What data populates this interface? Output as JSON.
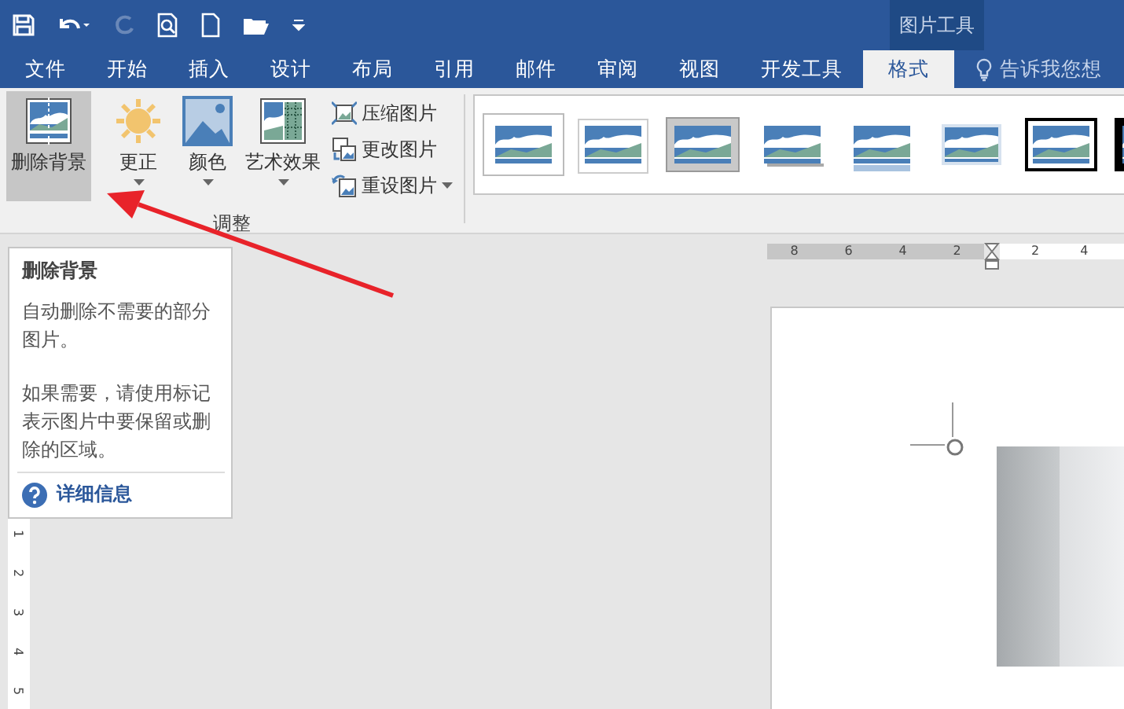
{
  "contextual_tab_group": "图片工具",
  "tabs": [
    {
      "label": "文件",
      "selected": false
    },
    {
      "label": "开始",
      "selected": false
    },
    {
      "label": "插入",
      "selected": false
    },
    {
      "label": "设计",
      "selected": false
    },
    {
      "label": "布局",
      "selected": false
    },
    {
      "label": "引用",
      "selected": false
    },
    {
      "label": "邮件",
      "selected": false
    },
    {
      "label": "审阅",
      "selected": false
    },
    {
      "label": "视图",
      "selected": false
    },
    {
      "label": "开发工具",
      "selected": false
    },
    {
      "label": "格式",
      "selected": true
    }
  ],
  "tell_me": "告诉我您想",
  "ribbon": {
    "large_buttons": [
      {
        "kind": "remove-background",
        "label": "删除背景",
        "selected": true,
        "dropdown": false
      },
      {
        "kind": "corrections",
        "label": "更正",
        "selected": false,
        "dropdown": true
      },
      {
        "kind": "color",
        "label": "颜色",
        "selected": false,
        "dropdown": true
      },
      {
        "kind": "artistic",
        "label": "艺术效果",
        "selected": false,
        "dropdown": true
      }
    ],
    "small_buttons": [
      {
        "kind": "compress",
        "label": "压缩图片",
        "dropdown": false
      },
      {
        "kind": "change",
        "label": "更改图片",
        "dropdown": false
      },
      {
        "kind": "reset",
        "label": "重设图片",
        "dropdown": true
      }
    ],
    "group_label": "调整",
    "picture_styles": [
      {
        "kind": "plain"
      },
      {
        "kind": "white-frame"
      },
      {
        "kind": "gray-frame"
      },
      {
        "kind": "soft-shadow"
      },
      {
        "kind": "reflection"
      },
      {
        "kind": "soft-edge"
      },
      {
        "kind": "double-frame"
      },
      {
        "kind": "black-frame"
      }
    ]
  },
  "ruler": {
    "left_numbers": [
      "8",
      "6",
      "4",
      "2"
    ],
    "right_numbers": [
      "2",
      "4"
    ]
  },
  "vertical_ruler": [
    "1",
    "2",
    "3",
    "4",
    "5"
  ],
  "tooltip": {
    "title": "删除背景",
    "paragraphs": [
      "自动删除不需要的部分图片。",
      "如果需要，请使用标记表示图片中要保留或删除的区域。"
    ],
    "link": "详细信息"
  }
}
